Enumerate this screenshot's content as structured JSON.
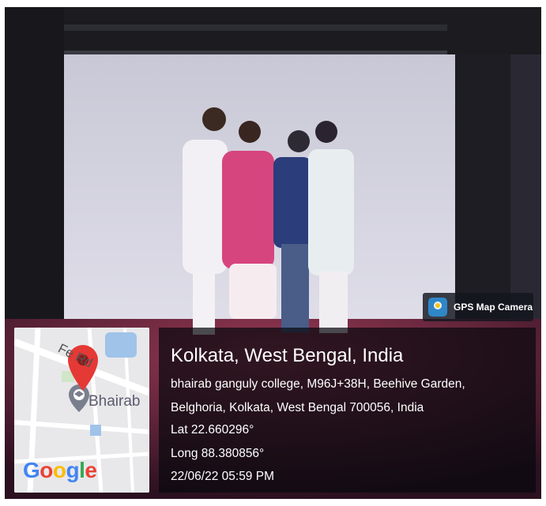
{
  "badge": {
    "label": "GPS Map Camera",
    "icon": "gps-map-camera-app-icon"
  },
  "map": {
    "street_label": "Fe     Rd",
    "place_label": "Bhairab",
    "logo": "Google",
    "pin_color": "#e53935",
    "college_marker_color": "#7a7f8e",
    "logo_colors": [
      "#4285f4",
      "#ea4335",
      "#fbbc05",
      "#4285f4",
      "#34a853",
      "#ea4335"
    ]
  },
  "info": {
    "title": "Kolkata, West Bengal, India",
    "address_line1": "bhairab ganguly college, M96J+38H, Beehive Garden,",
    "address_line2": "Belghoria, Kolkata, West Bengal 700056, India",
    "lat": "Lat 22.660296°",
    "long": "Long 88.380856°",
    "datetime": "22/06/22 05:59 PM"
  }
}
